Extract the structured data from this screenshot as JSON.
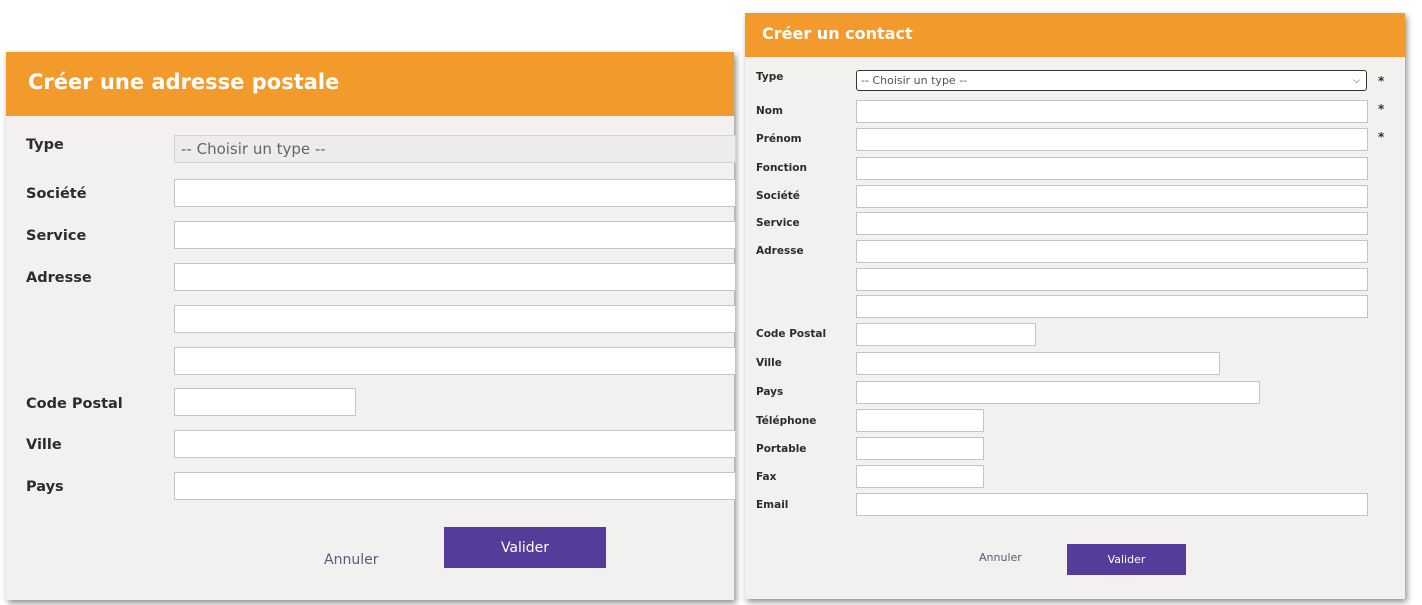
{
  "postal_dialog": {
    "title": "Créer une adresse postale",
    "labels": {
      "type": "Type",
      "societe": "Société",
      "service": "Service",
      "adresse": "Adresse",
      "code_postal": "Code Postal",
      "ville": "Ville",
      "pays": "Pays"
    },
    "type_select": {
      "selected": "-- Choisir un type --"
    },
    "fields": {
      "societe": "",
      "service": "",
      "adresse1": "",
      "adresse2": "",
      "adresse3": "",
      "code_postal": "",
      "ville": "",
      "pays": ""
    },
    "buttons": {
      "cancel": "Annuler",
      "submit": "Valider"
    }
  },
  "contact_dialog": {
    "title": "Créer un contact",
    "labels": {
      "type": "Type",
      "nom": "Nom",
      "prenom": "Prénom",
      "fonction": "Fonction",
      "societe": "Société",
      "service": "Service",
      "adresse": "Adresse",
      "code_postal": "Code Postal",
      "ville": "Ville",
      "pays": "Pays",
      "telephone": "Téléphone",
      "portable": "Portable",
      "fax": "Fax",
      "email": "Email"
    },
    "type_select": {
      "selected": "-- Choisir un type --"
    },
    "required_marker": "*",
    "fields": {
      "nom": "",
      "prenom": "",
      "fonction": "",
      "societe": "",
      "service": "",
      "adresse1": "",
      "adresse2": "",
      "adresse3": "",
      "code_postal": "",
      "ville": "",
      "pays": "",
      "telephone": "",
      "portable": "",
      "fax": "",
      "email": ""
    },
    "buttons": {
      "cancel": "Annuler",
      "submit": "Valider"
    }
  },
  "colors": {
    "header": "#f39a2c",
    "primary_button": "#553c9a",
    "panel_bg": "#f2f1ef"
  }
}
